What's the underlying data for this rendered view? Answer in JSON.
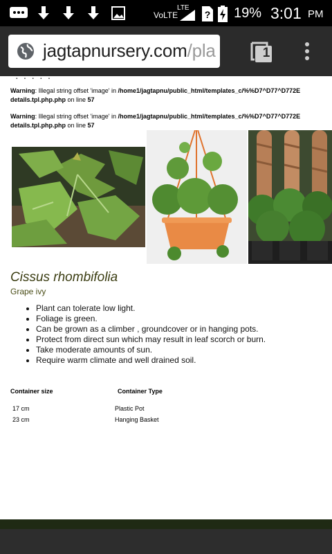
{
  "status_bar": {
    "network": "VoLTE",
    "network_type": "LTE",
    "battery": "19%",
    "time": "3:01",
    "ampm": "PM"
  },
  "browser": {
    "url_host": "jagtapnursery.com",
    "url_path": "/pla",
    "tab_count": "1"
  },
  "warnings": [
    {
      "label": "Warning",
      "text": ": Illegal string offset 'image' in ",
      "path": "/home1/jagtapnu/public_html/templates_c/%%D7^D77^D772E",
      "file": "details.tpl.php.php",
      "line_text": " on line ",
      "line": "57"
    },
    {
      "label": "Warning",
      "text": ": Illegal string offset 'image' in ",
      "path": "/home1/jagtapnu/public_html/templates_c/%%D7^D77^D772E",
      "file": "details.tpl.php.php",
      "line_text": " on line ",
      "line": "57"
    }
  ],
  "plant": {
    "botanical_name": "Cissus rhombifolia",
    "common_name": "Grape ivy",
    "features": [
      "Plant can tolerate low light.",
      "Foliage is green.",
      "Can be grown as a climber , groundcover or in hanging pots.",
      "Protect from direct sun which may result in leaf scorch or burn.",
      "Take moderate amounts of sun.",
      "Require warm climate and well drained soil."
    ]
  },
  "container_table": {
    "headers": [
      "Container size",
      "Container Type"
    ],
    "rows": [
      [
        "17 cm",
        "Plastic Pot"
      ],
      [
        "23 cm",
        "Hanging Basket"
      ]
    ]
  }
}
